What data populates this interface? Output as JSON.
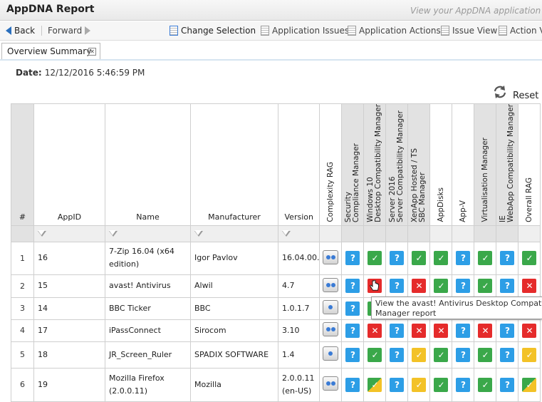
{
  "app": {
    "title": "AppDNA Report",
    "subtitle": "View your AppDNA application rep"
  },
  "toolbar": {
    "back": "Back",
    "forward": "Forward",
    "change_selection": "Change Selection",
    "application_issues": "Application Issues",
    "application_actions": "Application Actions",
    "issue_view": "Issue View",
    "action_view": "Action V"
  },
  "tab": {
    "label": "Overview Summary"
  },
  "report": {
    "date_label": "Date:",
    "date_value": "12/12/2016 5:46:59 PM",
    "reset": "Reset"
  },
  "table": {
    "headers": {
      "num": "#",
      "appid": "AppID",
      "name": "Name",
      "manufacturer": "Manufacturer",
      "version": "Version",
      "complexity": "Complexity RAG",
      "security": "Security\nCompliance Manager",
      "win10": "Windows 10\nDesktop Compatibility Manager",
      "server2016": "Server 2016\nServer Compatibility Manager",
      "xenapp": "XenApp Hosted / TS\nSBC Manager",
      "appdisks": "AppDisks",
      "appv": "App-V",
      "virt": "Virtualisation Manager",
      "ie": "IE\nWebApp Compatibility Manager",
      "overall": "Overall RAG"
    },
    "rows": [
      {
        "num": "1",
        "appid": "16",
        "name": "7-Zip 16.04 (x64 edition)",
        "manufacturer": "Igor Pavlov",
        "version": "16.04.00.",
        "complexity": 2,
        "status": [
          "q",
          "ok",
          "q",
          "ok",
          "ok",
          "q",
          "ok",
          "q",
          "ok"
        ]
      },
      {
        "num": "2",
        "appid": "15",
        "name": "avast! Antivirus",
        "manufacturer": "Alwil",
        "version": "4.7",
        "complexity": 2,
        "status": [
          "q",
          "x",
          "q",
          "x",
          "ok",
          "q",
          "ok",
          "q",
          "x"
        ]
      },
      {
        "num": "3",
        "appid": "14",
        "name": "BBC Ticker",
        "manufacturer": "BBC",
        "version": "1.0.1.7",
        "complexity": 1,
        "status": [
          "q",
          "ok",
          "q",
          "y",
          "ok",
          "q",
          "ok",
          "q",
          "y"
        ]
      },
      {
        "num": "4",
        "appid": "17",
        "name": "iPassConnect",
        "manufacturer": "Sirocom",
        "version": "3.10",
        "complexity": 2,
        "status": [
          "q",
          "x",
          "q",
          "x",
          "x",
          "q",
          "x",
          "q",
          "x"
        ]
      },
      {
        "num": "5",
        "appid": "18",
        "name": "JR_Screen_Ruler",
        "manufacturer": "SPADIX SOFTWARE",
        "version": "1.4",
        "complexity": 1,
        "status": [
          "q",
          "ok",
          "q",
          "y",
          "ok",
          "q",
          "ok",
          "q",
          "y"
        ]
      },
      {
        "num": "6",
        "appid": "19",
        "name": "Mozilla Firefox (2.0.0.11)",
        "manufacturer": "Mozilla",
        "version": "2.0.0.11 (en-US)",
        "complexity": 2,
        "status": [
          "q",
          "gy",
          "q",
          "y",
          "ok",
          "q",
          "ok",
          "q",
          "gy"
        ]
      }
    ]
  },
  "tooltip": {
    "line1": "View the avast! Antivirus Desktop Compatibi",
    "line2": "Manager report"
  }
}
